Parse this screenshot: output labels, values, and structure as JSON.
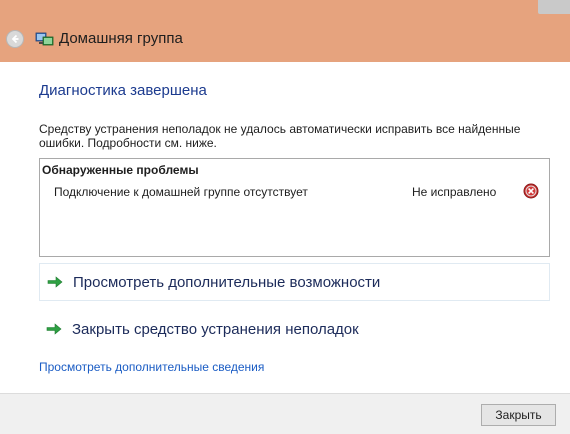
{
  "window": {
    "title": "Домашняя группа"
  },
  "main": {
    "heading": "Диагностика завершена",
    "description": "Средству устранения неполадок не удалось автоматически исправить все найденные ошибки. Подробности см. ниже."
  },
  "problems": {
    "header": "Обнаруженные проблемы",
    "items": [
      {
        "name": "Подключение к домашней группе отсутствует",
        "status": "Не исправлено",
        "status_icon": "error-icon"
      }
    ]
  },
  "options": [
    {
      "label": "Просмотреть дополнительные возможности",
      "icon": "green-arrow-icon"
    },
    {
      "label": "Закрыть средство устранения неполадок",
      "icon": "green-arrow-icon"
    }
  ],
  "links": {
    "more_info": "Просмотреть дополнительные сведения"
  },
  "footer": {
    "close_label": "Закрыть"
  },
  "colors": {
    "titlebar": "#e6a37e",
    "heading": "#1c3b8f",
    "link": "#1a5cc4",
    "arrow": "#2ea043",
    "error": "#c42b2b"
  }
}
